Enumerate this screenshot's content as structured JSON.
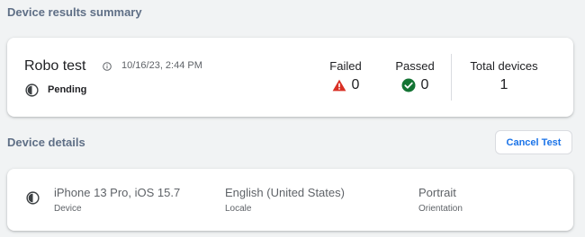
{
  "summary": {
    "section_title": "Device results summary",
    "test_name": "Robo test",
    "timestamp": "10/16/23, 2:44 PM",
    "status": "Pending",
    "status_icon": "pending-half-circle-icon",
    "failed": {
      "label": "Failed",
      "value": "0",
      "icon": "warning-icon",
      "color": "#d93025"
    },
    "passed": {
      "label": "Passed",
      "value": "0",
      "icon": "check-circle-icon",
      "color": "#137333"
    },
    "total": {
      "label": "Total devices",
      "value": "1"
    }
  },
  "details": {
    "section_title": "Device details",
    "cancel_label": "Cancel Test",
    "device": {
      "value": "iPhone 13 Pro, iOS 15.7",
      "label": "Device"
    },
    "locale": {
      "value": "English (United States)",
      "label": "Locale"
    },
    "orientation": {
      "value": "Portrait",
      "label": "Orientation"
    }
  },
  "colors": {
    "accent": "#1a73e8",
    "section_title": "#5f6f86",
    "background": "#f1f3f4"
  }
}
